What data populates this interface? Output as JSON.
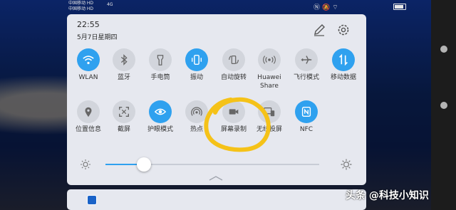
{
  "status_bar": {
    "carrier1": "中国移动 HD",
    "carrier2": "中国移动 HD",
    "network": "4G",
    "icons": [
      "nfc-icon",
      "mute-icon",
      "wifi-icon",
      "battery-icon"
    ]
  },
  "header": {
    "time": "22:55",
    "date": "5月7日星期四",
    "edit_icon": "pencil-icon",
    "settings_icon": "gear-icon"
  },
  "toggles": [
    {
      "label": "WLAN",
      "icon": "wifi-icon",
      "on": true
    },
    {
      "label": "蓝牙",
      "icon": "bluetooth-icon",
      "on": false
    },
    {
      "label": "手电筒",
      "icon": "flashlight-icon",
      "on": false
    },
    {
      "label": "振动",
      "icon": "vibrate-icon",
      "on": true
    },
    {
      "label": "自动旋转",
      "icon": "rotate-icon",
      "on": false
    },
    {
      "label": "Huawei Share",
      "icon": "share-icon",
      "on": false
    },
    {
      "label": "飞行模式",
      "icon": "airplane-icon",
      "on": false
    },
    {
      "label": "移动数据",
      "icon": "data-icon",
      "on": true
    },
    {
      "label": "位置信息",
      "icon": "location-icon",
      "on": false
    },
    {
      "label": "截屏",
      "icon": "screenshot-icon",
      "on": false
    },
    {
      "label": "护眼模式",
      "icon": "eye-icon",
      "on": true
    },
    {
      "label": "热点",
      "icon": "hotspot-icon",
      "on": false
    },
    {
      "label": "屏幕录制",
      "icon": "screen-record-icon",
      "on": false
    },
    {
      "label": "无线投屏",
      "icon": "cast-icon",
      "on": false
    },
    {
      "label": "NFC",
      "icon": "nfc-icon",
      "on": true
    }
  ],
  "brightness": {
    "level": 0.18
  },
  "colors": {
    "accent": "#2fa1ef",
    "panel": "#e6e8ef",
    "annotation": "#f5c218"
  },
  "watermark": "头条 @科技小知识"
}
